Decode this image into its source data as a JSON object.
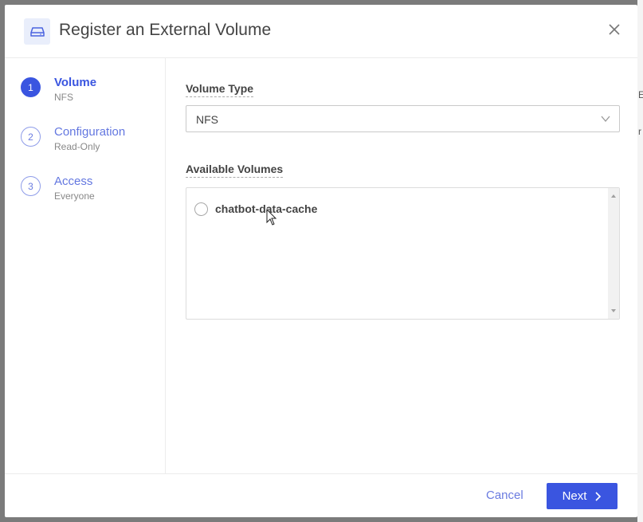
{
  "dialog": {
    "title": "Register an External Volume",
    "header_icon": "drive-icon",
    "close_icon": "close-icon"
  },
  "steps": [
    {
      "number": "1",
      "label": "Volume",
      "sublabel": "NFS",
      "active": true
    },
    {
      "number": "2",
      "label": "Configuration",
      "sublabel": "Read-Only",
      "active": false
    },
    {
      "number": "3",
      "label": "Access",
      "sublabel": "Everyone",
      "active": false
    }
  ],
  "form": {
    "volume_type_label": "Volume Type",
    "volume_type_value": "NFS",
    "available_volumes_label": "Available Volumes",
    "volumes": [
      {
        "name": "chatbot-data-cache",
        "selected": false
      }
    ]
  },
  "footer": {
    "cancel_label": "Cancel",
    "next_label": "Next",
    "next_icon": "chevron-right-icon"
  },
  "colors": {
    "accent": "#3a55e0",
    "link": "#6a7be0"
  }
}
